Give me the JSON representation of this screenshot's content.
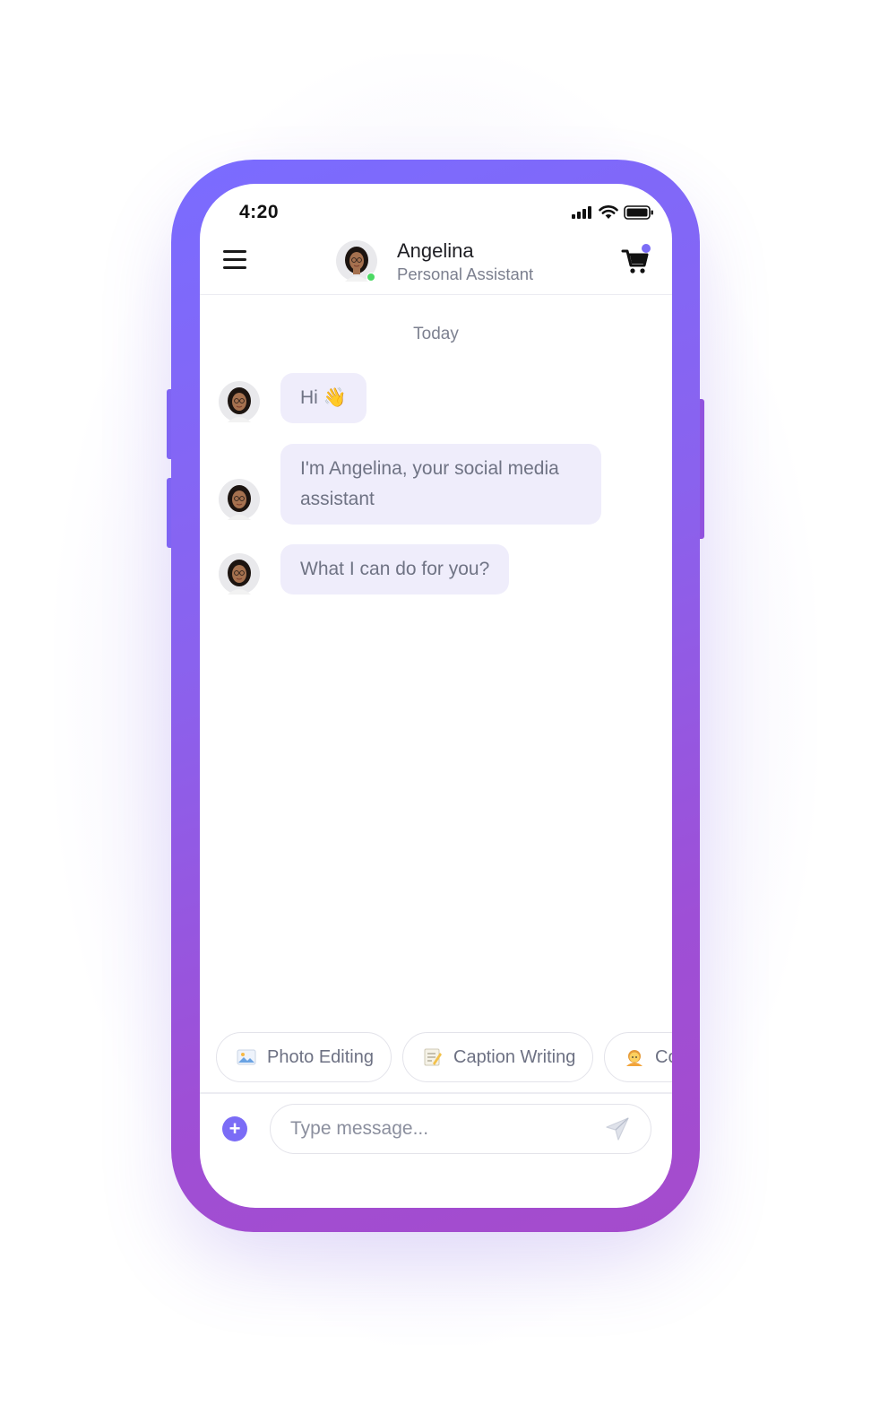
{
  "status_bar": {
    "time": "4:20",
    "icons": [
      "signal-icon",
      "wifi-icon",
      "battery-icon"
    ]
  },
  "header": {
    "name": "Angelina",
    "role": "Personal Assistant",
    "online": true,
    "icons": [
      "menu-icon",
      "cart-icon"
    ]
  },
  "chat": {
    "day_label": "Today",
    "messages": [
      {
        "text": "Hi",
        "emoji": "👋"
      },
      {
        "text": "I'm Angelina, your social media assistant"
      },
      {
        "text": "What I can do for you?"
      }
    ]
  },
  "suggestions": [
    {
      "label": "Photo Editing",
      "icon": "picture-icon"
    },
    {
      "label": "Caption Writing",
      "icon": "memo-icon"
    },
    {
      "label": "Co",
      "icon": "person-icon"
    }
  ],
  "composer": {
    "placeholder": "Type message...",
    "plus_label": "+",
    "icons": [
      "plus-icon",
      "send-icon"
    ]
  },
  "colors": {
    "frame_start": "#7a6cff",
    "frame_end": "#a54bcc",
    "accent": "#7b6cf6",
    "bubble": "#efedfb",
    "online": "#4cd964"
  }
}
